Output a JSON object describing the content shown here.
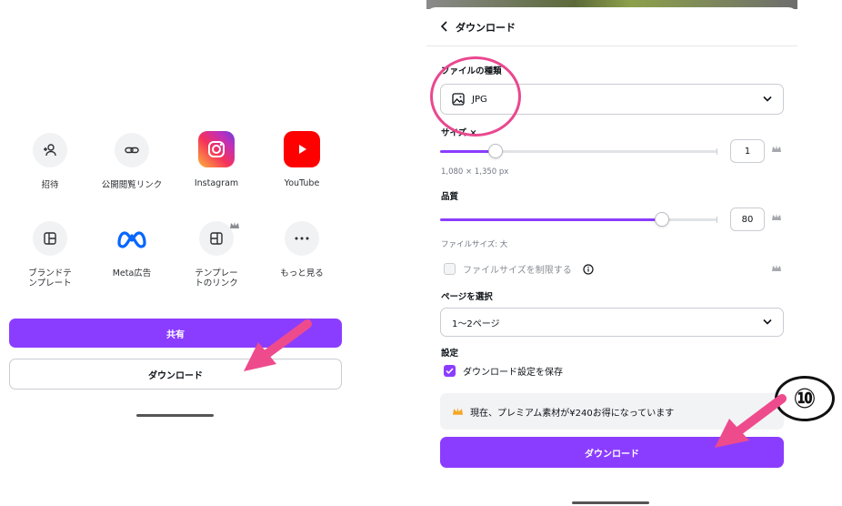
{
  "share_sheet": {
    "items": [
      {
        "label": "招待",
        "icon": "add-user-icon"
      },
      {
        "label": "公開閲覧リンク",
        "icon": "link-icon"
      },
      {
        "label": "Instagram",
        "icon": "instagram-icon"
      },
      {
        "label": "YouTube",
        "icon": "youtube-icon"
      },
      {
        "label": "ブランドテ\nンプレート",
        "icon": "brand-template-icon"
      },
      {
        "label": "Meta広告",
        "icon": "meta-icon"
      },
      {
        "label": "テンプレー\nトのリンク",
        "icon": "template-link-icon"
      },
      {
        "label": "もっと見る",
        "icon": "more-icon"
      }
    ],
    "share_button": "共有",
    "download_button": "ダウンロード"
  },
  "download_panel": {
    "title": "ダウンロード",
    "file_type_label": "ファイルの種類",
    "file_type_value": "JPG",
    "size_label": "サイズ ×",
    "size_value": "1",
    "size_fraction": 0.2,
    "dimensions": "1,080 × 1,350 px",
    "quality_label": "品質",
    "quality_value": "80",
    "quality_fraction": 0.8,
    "file_size_text": "ファイルサイズ: 大",
    "limit_file_size_label": "ファイルサイズを制限する",
    "limit_file_size_checked": false,
    "page_select_label": "ページを選択",
    "page_select_value": "1〜2ページ",
    "settings_label": "設定",
    "save_settings_label": "ダウンロード設定を保存",
    "save_settings_checked": true,
    "promo_text": "現在、プレミアム素材が¥240お得になっています",
    "download_button": "ダウンロード"
  },
  "annotations": {
    "step_number": "⑩"
  },
  "colors": {
    "accent": "#8b3dff",
    "annotation": "#ee4b8d"
  }
}
